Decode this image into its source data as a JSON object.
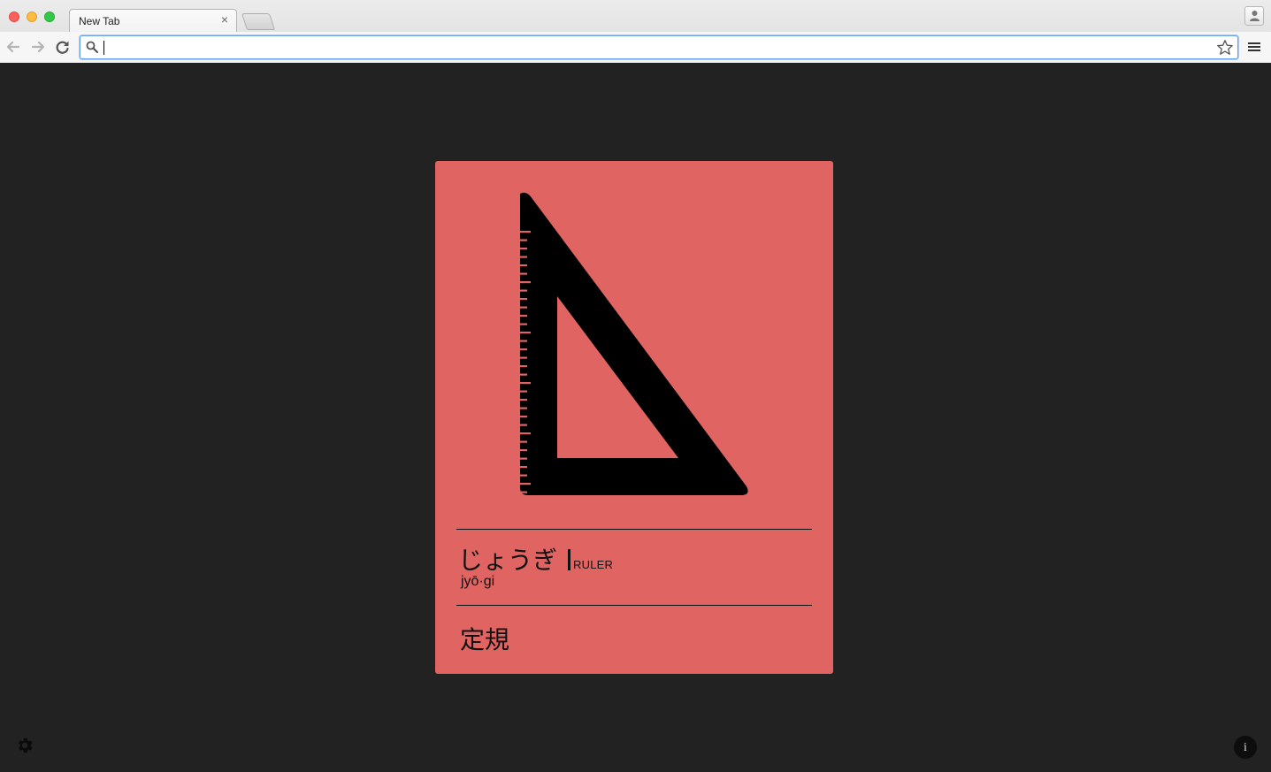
{
  "browser": {
    "tab": {
      "title": "New Tab",
      "close_glyph": "×"
    },
    "address_bar": {
      "value": "",
      "placeholder": ""
    },
    "icons": {
      "back": "arrow-left-icon",
      "forward": "arrow-right-icon",
      "reload": "reload-icon",
      "search": "magnifier-icon",
      "bookmark": "star-icon",
      "menu": "hamburger-icon",
      "profile": "person-icon"
    }
  },
  "card": {
    "background_color": "#e06461",
    "illustration": "set-square-ruler-icon",
    "word": {
      "kana": "じょうぎ",
      "english": "RULER",
      "romaji": "jyō·gi",
      "kanji": "定規"
    }
  },
  "footer": {
    "settings_icon": "gear-icon",
    "info_label": "i"
  }
}
